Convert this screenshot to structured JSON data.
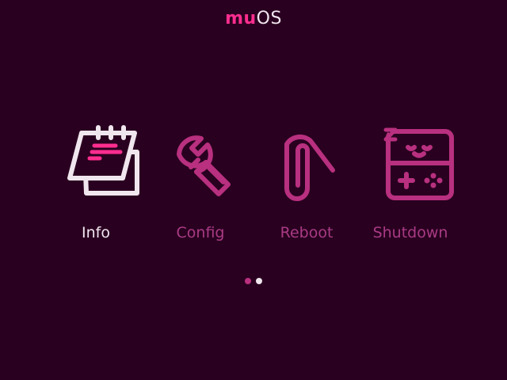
{
  "header": {
    "title_part1": "mu",
    "title_part2": "OS"
  },
  "menu": {
    "items": [
      {
        "label": "Info",
        "icon": "notepad-icon",
        "selected": true
      },
      {
        "label": "Config",
        "icon": "wrench-icon",
        "selected": false
      },
      {
        "label": "Reboot",
        "icon": "paperclip-icon",
        "selected": false
      },
      {
        "label": "Shutdown",
        "icon": "sleeping-gameboy-icon",
        "selected": false
      }
    ]
  },
  "pagination": {
    "total_pages": 2,
    "current_page": 2
  },
  "colors": {
    "background": "#2a0020",
    "accent": "#ff2d8f",
    "icon_inactive": "#b8307f",
    "label_inactive": "#a83b84",
    "selected": "#f0e6ee"
  }
}
